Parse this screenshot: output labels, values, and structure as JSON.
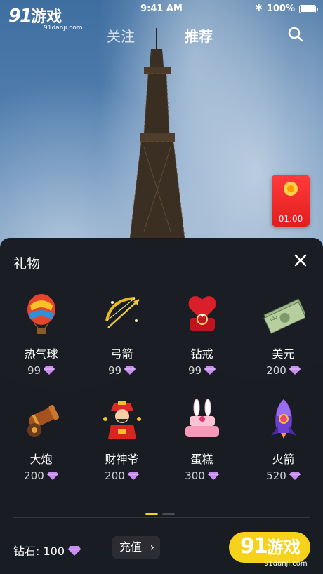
{
  "status_bar": {
    "time": "9:41 AM",
    "battery_text": "100%",
    "bluetooth_icon": "bluetooth-icon"
  },
  "watermark": {
    "number": "91",
    "text": "游戏",
    "url": "91danji.com"
  },
  "nav": {
    "tabs": [
      {
        "label": "关注",
        "active": false
      },
      {
        "label": "推荐",
        "active": true
      }
    ],
    "search_icon": "search-icon"
  },
  "red_packet": {
    "timer": "01:00"
  },
  "gift_panel": {
    "title": "礼物",
    "gifts": [
      {
        "name": "热气球",
        "price": "99",
        "icon": "hot-air-balloon-icon"
      },
      {
        "name": "弓箭",
        "price": "99",
        "icon": "bow-arrow-icon"
      },
      {
        "name": "钻戒",
        "price": "99",
        "icon": "diamond-ring-icon"
      },
      {
        "name": "美元",
        "price": "200",
        "icon": "dollar-bills-icon"
      },
      {
        "name": "大炮",
        "price": "200",
        "icon": "cannon-icon"
      },
      {
        "name": "财神爷",
        "price": "200",
        "icon": "god-of-wealth-icon"
      },
      {
        "name": "蛋糕",
        "price": "300",
        "icon": "cake-icon"
      },
      {
        "name": "火箭",
        "price": "520",
        "icon": "rocket-icon"
      }
    ],
    "page_indicator": {
      "active_index": 0,
      "total": 2
    },
    "balance": {
      "label": "钻石:",
      "value": "100"
    },
    "recharge_label": "充值",
    "colors": {
      "accent": "#f6d31a",
      "gem": "#c98cf5",
      "panel_bg": "#16181e"
    }
  }
}
